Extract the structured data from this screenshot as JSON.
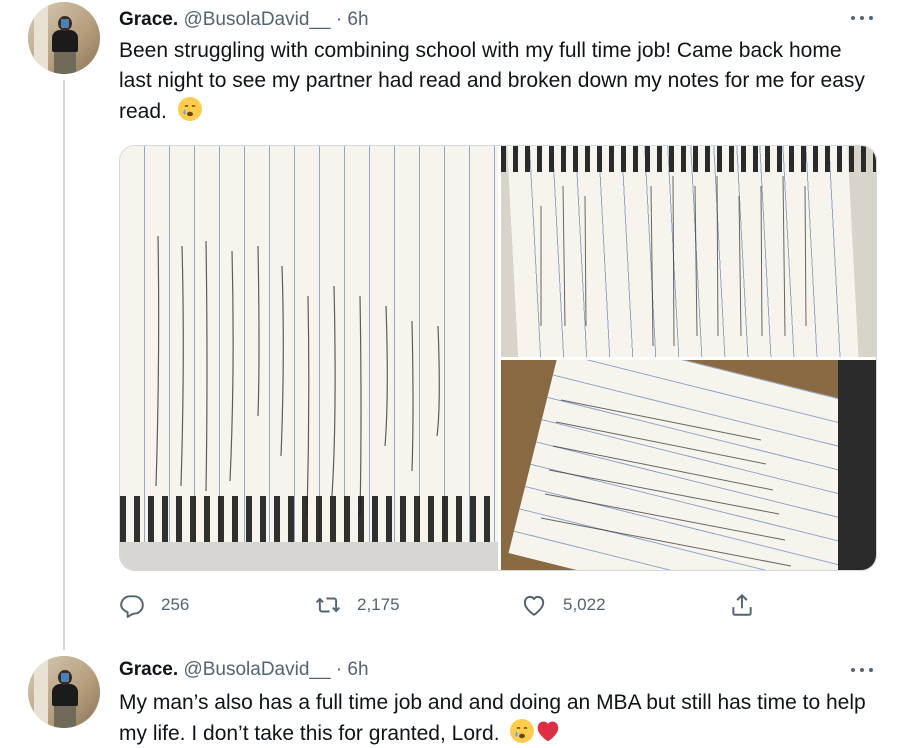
{
  "tweets": [
    {
      "author_name": "Grace.",
      "handle": "@BusolaDavid__",
      "separator": "·",
      "time": "6h",
      "text": "Been struggling with combining school with my full time job! Came back home last night to see my partner had read and broken down my notes for me for easy read.",
      "emojis": [
        "crying-face"
      ],
      "stats": {
        "replies": "256",
        "retweets": "2,175",
        "likes": "5,022"
      }
    },
    {
      "author_name": "Grace.",
      "handle": "@BusolaDavid__",
      "separator": "·",
      "time": "6h",
      "text": "My man’s also has a full time job and and doing an MBA but still has time to help my life. I don’t take this for granted, Lord.",
      "emojis": [
        "crying-face",
        "red-heart"
      ]
    }
  ],
  "media": {
    "photos": [
      "handwritten-notes-photo-1",
      "handwritten-notes-photo-2",
      "handwritten-notes-photo-3"
    ]
  },
  "icons": {
    "reply": "reply-icon",
    "retweet": "retweet-icon",
    "like": "like-icon",
    "share": "share-icon",
    "more": "more-icon"
  },
  "colors": {
    "text": "#0f1419",
    "secondary": "#536471",
    "border": "#cfd9de",
    "heart": "#e0245e"
  }
}
